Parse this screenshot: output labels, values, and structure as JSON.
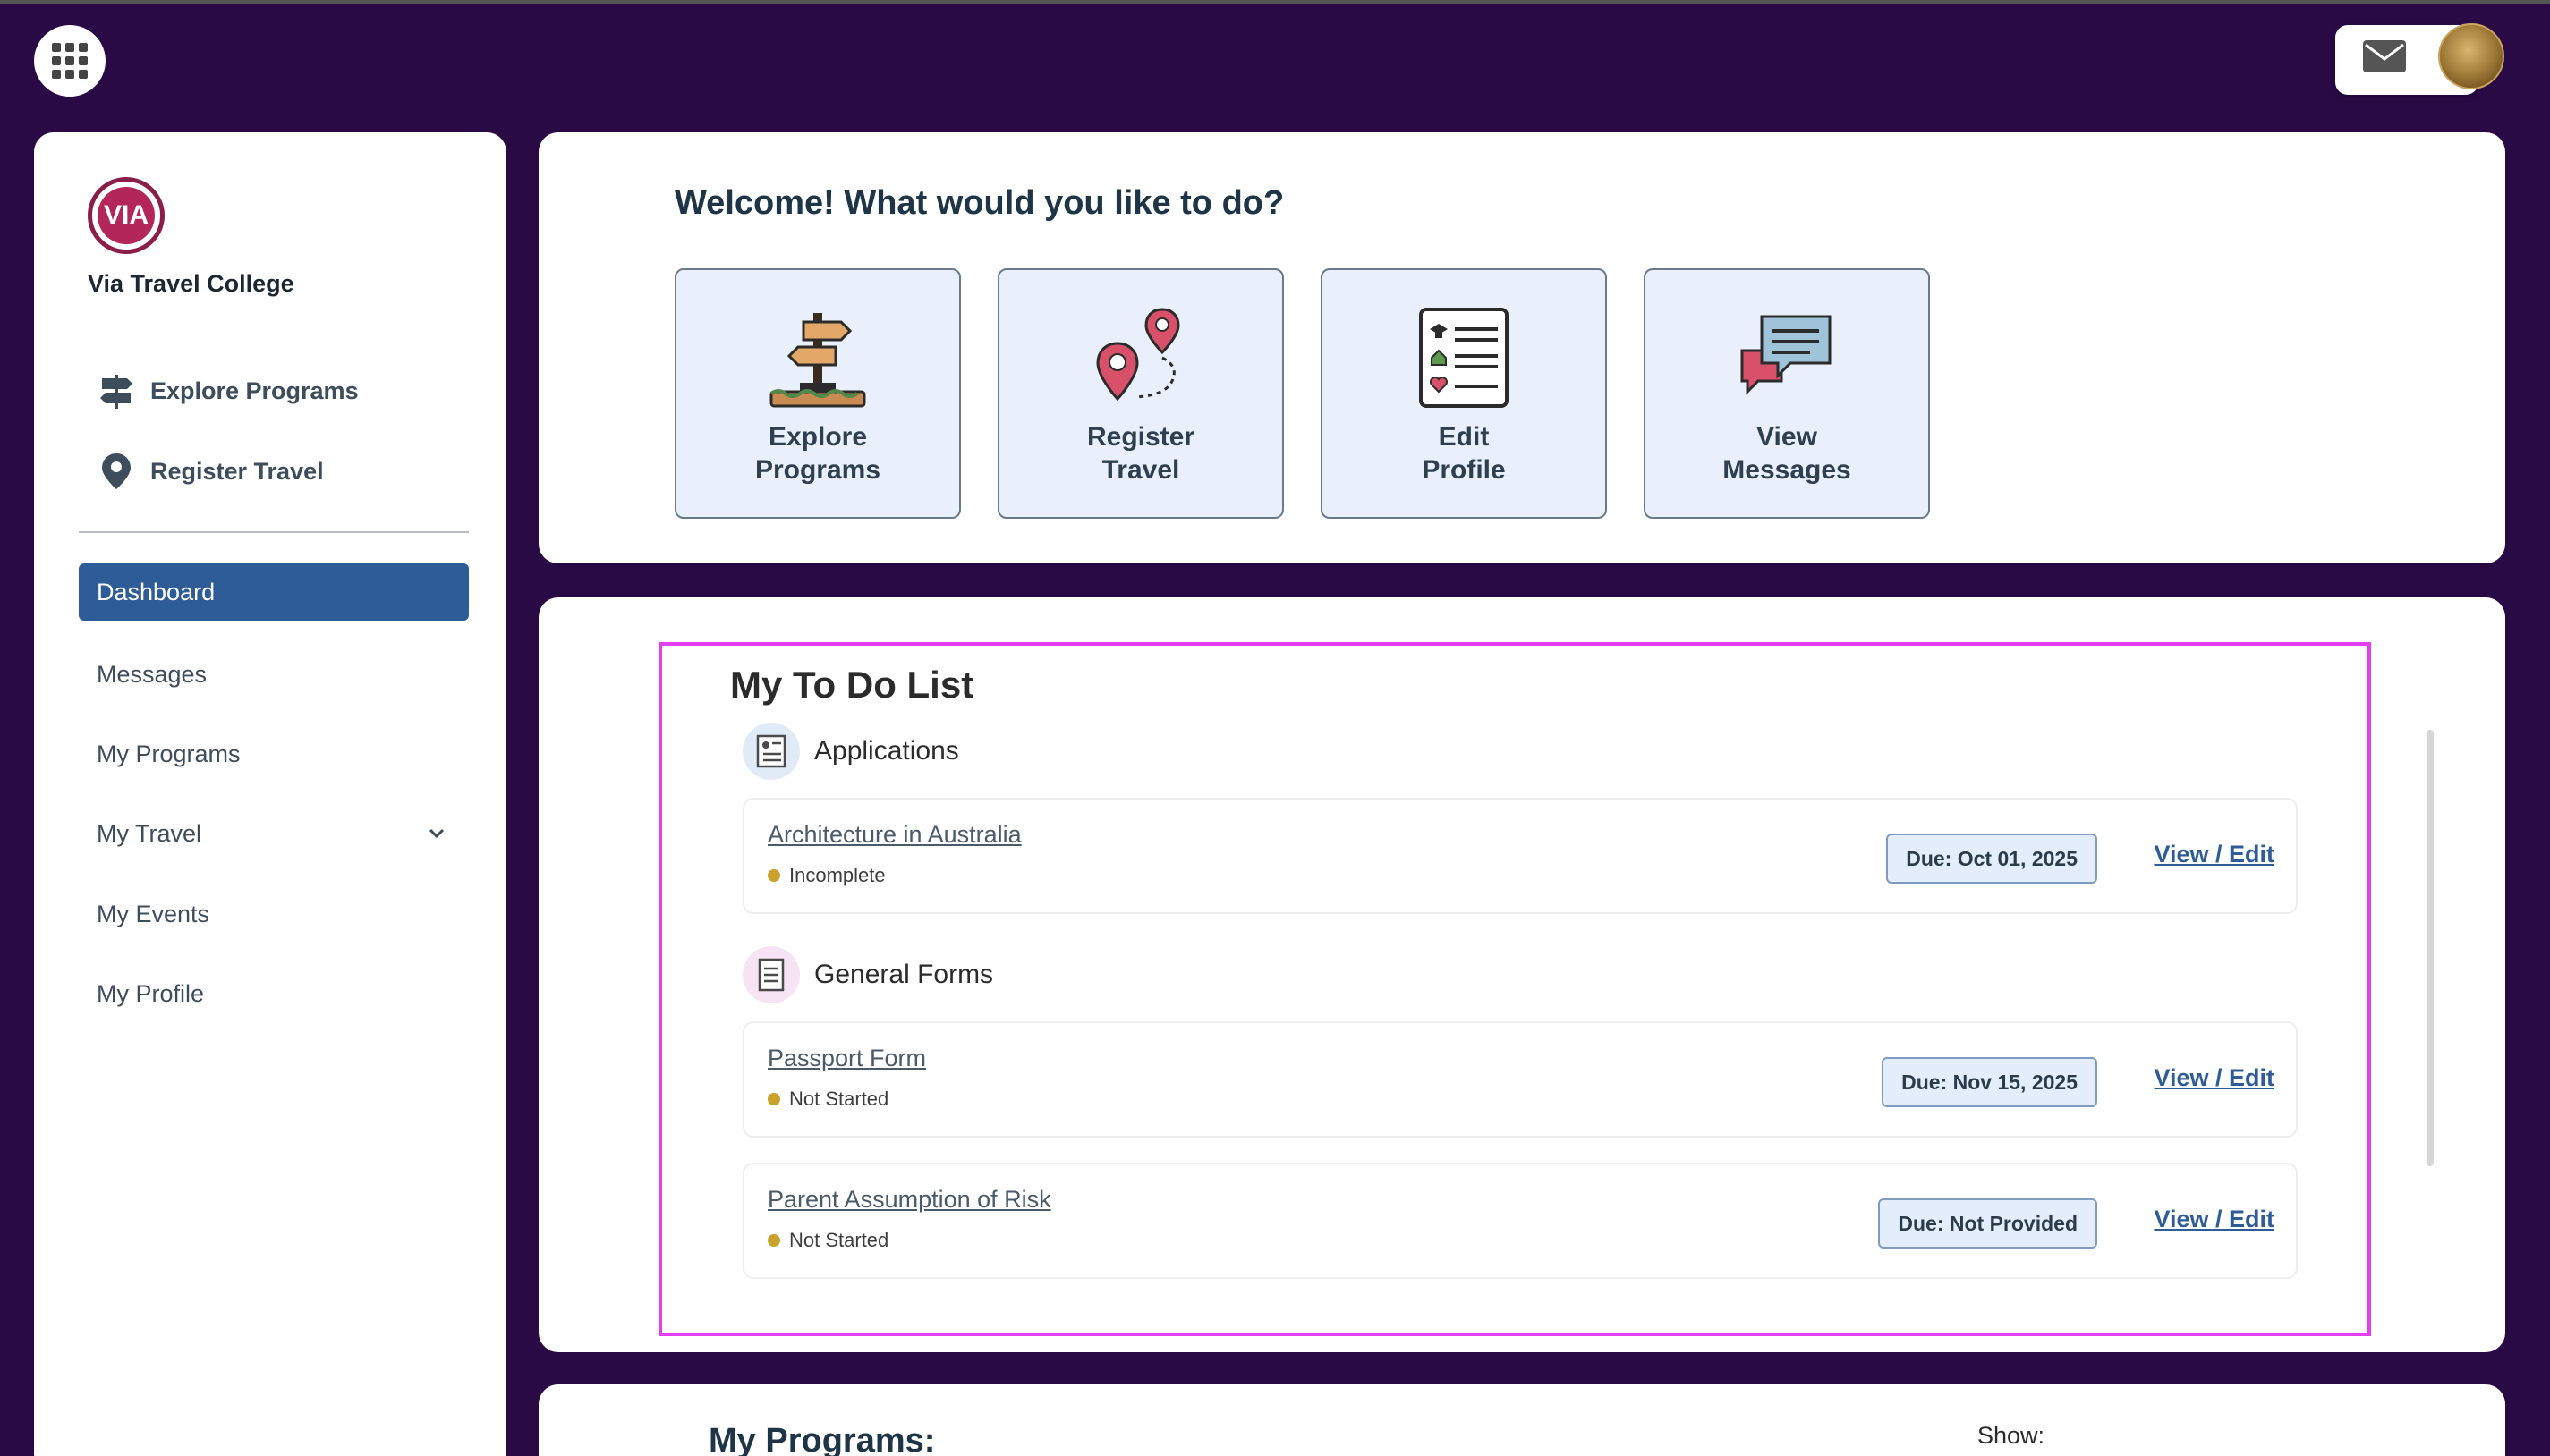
{
  "app": {
    "org_name": "Via Travel College",
    "logo_text": "VIA"
  },
  "topbar": {
    "apps_icon": "grid-icon",
    "mail_icon": "envelope-icon"
  },
  "sidebar": {
    "quick_links": [
      {
        "label": "Explore Programs",
        "icon": "signpost-icon"
      },
      {
        "label": "Register Travel",
        "icon": "map-pin-icon"
      }
    ],
    "nav": [
      {
        "label": "Dashboard",
        "active": true
      },
      {
        "label": "Messages"
      },
      {
        "label": "My Programs"
      },
      {
        "label": "My Travel",
        "has_children": true
      },
      {
        "label": "My Events"
      },
      {
        "label": "My Profile"
      }
    ]
  },
  "welcome": {
    "title": "Welcome! What would you like to do?",
    "actions": [
      {
        "label": "Explore\nPrograms",
        "icon": "signpost-icon"
      },
      {
        "label": "Register\nTravel",
        "icon": "map-pins-icon"
      },
      {
        "label": "Edit\nProfile",
        "icon": "checklist-icon"
      },
      {
        "label": "View\nMessages",
        "icon": "chat-bubbles-icon"
      }
    ]
  },
  "todo": {
    "title": "My To Do List",
    "sections": [
      {
        "label": "Applications",
        "items": [
          {
            "name": "Architecture in Australia",
            "status": "Incomplete",
            "due": "Due: Oct 01, 2025",
            "action": "View / Edit"
          }
        ]
      },
      {
        "label": "General Forms",
        "items": [
          {
            "name": "Passport Form",
            "status": "Not Started",
            "due": "Due: Nov 15, 2025",
            "action": "View / Edit"
          },
          {
            "name": "Parent Assumption of Risk",
            "status": "Not Started",
            "due": "Due: Not Provided",
            "action": "View / Edit"
          }
        ]
      }
    ]
  },
  "programs": {
    "title": "My Programs:",
    "show_label": "Show:"
  },
  "colors": {
    "background": "#2a0a45",
    "primary": "#2e5c96",
    "highlight_border": "#e23ff0",
    "status_dot": "#c9a22b"
  }
}
